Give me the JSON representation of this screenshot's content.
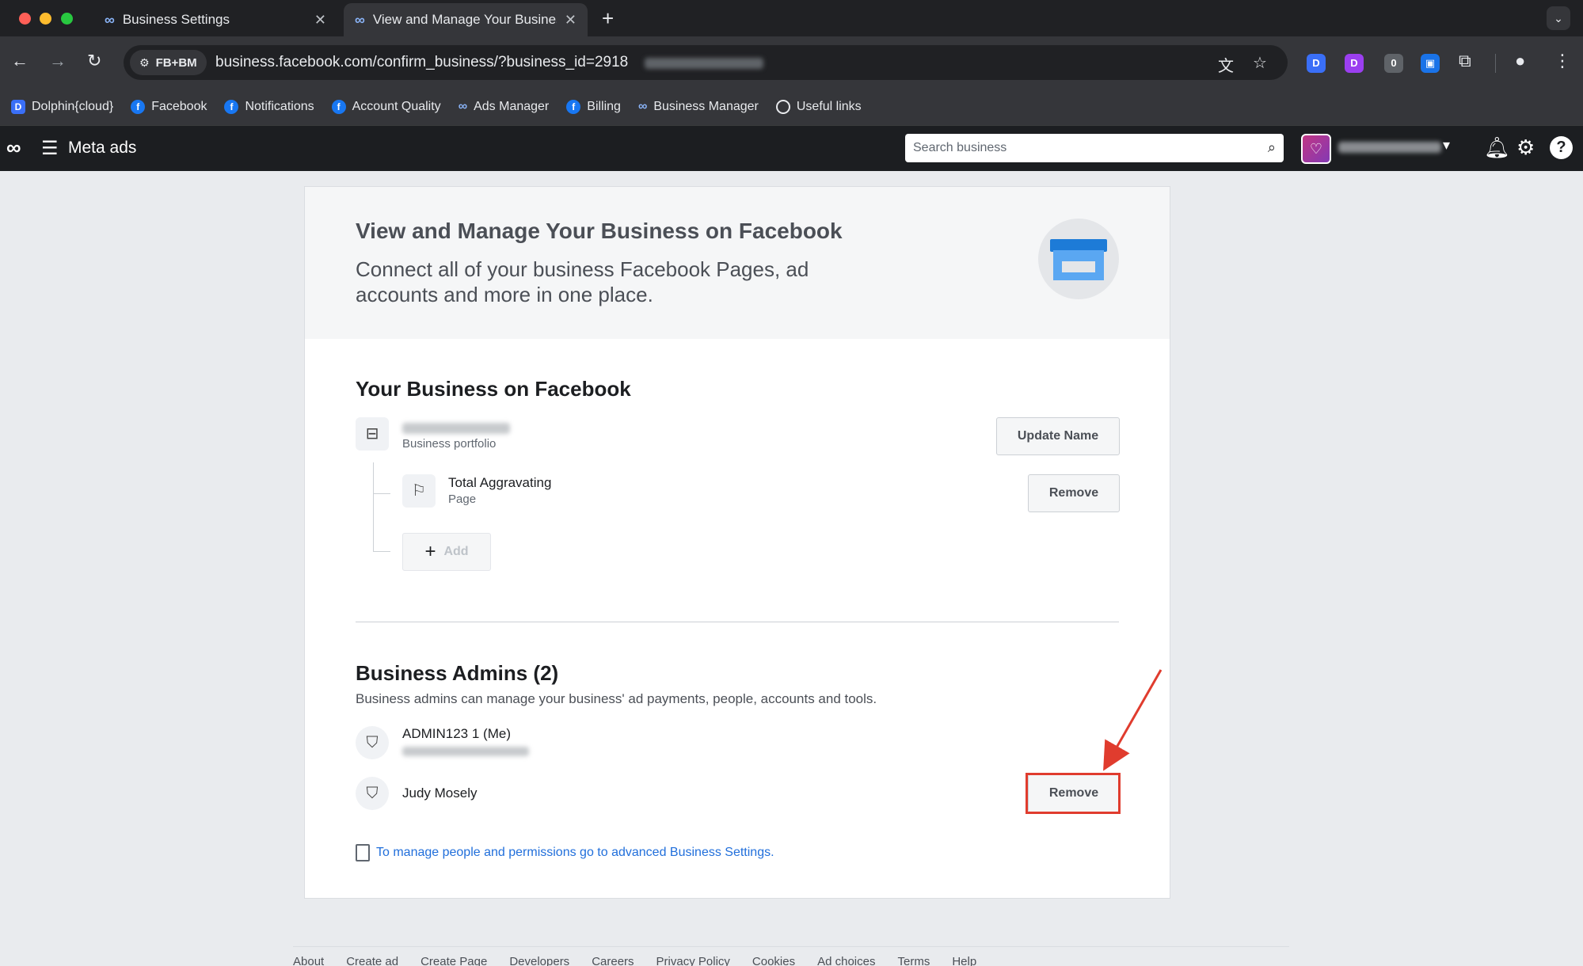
{
  "browser": {
    "tabs": [
      {
        "title": "Business Settings",
        "active": false
      },
      {
        "title": "View and Manage Your Business",
        "active": true
      }
    ],
    "site_chip": "FB+BM",
    "url": "business.facebook.com/confirm_business/?business_id=2918",
    "bookmarks": [
      {
        "label": "Dolphin{cloud}",
        "icon": "dolphin-icon"
      },
      {
        "label": "Facebook",
        "icon": "facebook-icon"
      },
      {
        "label": "Notifications",
        "icon": "facebook-icon"
      },
      {
        "label": "Account Quality",
        "icon": "facebook-icon"
      },
      {
        "label": "Ads Manager",
        "icon": "meta-icon"
      },
      {
        "label": "Billing",
        "icon": "facebook-icon"
      },
      {
        "label": "Business Manager",
        "icon": "meta-icon"
      },
      {
        "label": "Useful links",
        "icon": "folder-icon"
      }
    ]
  },
  "app": {
    "title": "Meta ads",
    "search_placeholder": "Search business"
  },
  "hero": {
    "title": "View and Manage Your Business on Facebook",
    "subtitle": "Connect all of your business Facebook Pages, ad accounts and more in one place."
  },
  "business": {
    "section_title": "Your Business on Facebook",
    "portfolio_label": "Business portfolio",
    "update_name_label": "Update Name",
    "page_name": "Total Aggravating",
    "page_type": "Page",
    "remove_label": "Remove",
    "add_label": "Add"
  },
  "admins": {
    "section_title": "Business Admins (2)",
    "description": "Business admins can manage your business' ad payments, people, accounts and tools.",
    "list": [
      {
        "name": "ADMIN123 1 (Me)"
      },
      {
        "name": "Judy Mosely"
      }
    ],
    "remove_label": "Remove",
    "settings_link": "To manage people and permissions go to advanced Business Settings."
  },
  "footer": {
    "links": [
      "About",
      "Create ad",
      "Create Page",
      "Developers",
      "Careers",
      "Privacy Policy",
      "Cookies",
      "Ad choices",
      "Terms",
      "Help"
    ]
  },
  "colors": {
    "highlight": "#e03c2e",
    "link": "#216fdb",
    "app_bar": "#1c1e21"
  }
}
